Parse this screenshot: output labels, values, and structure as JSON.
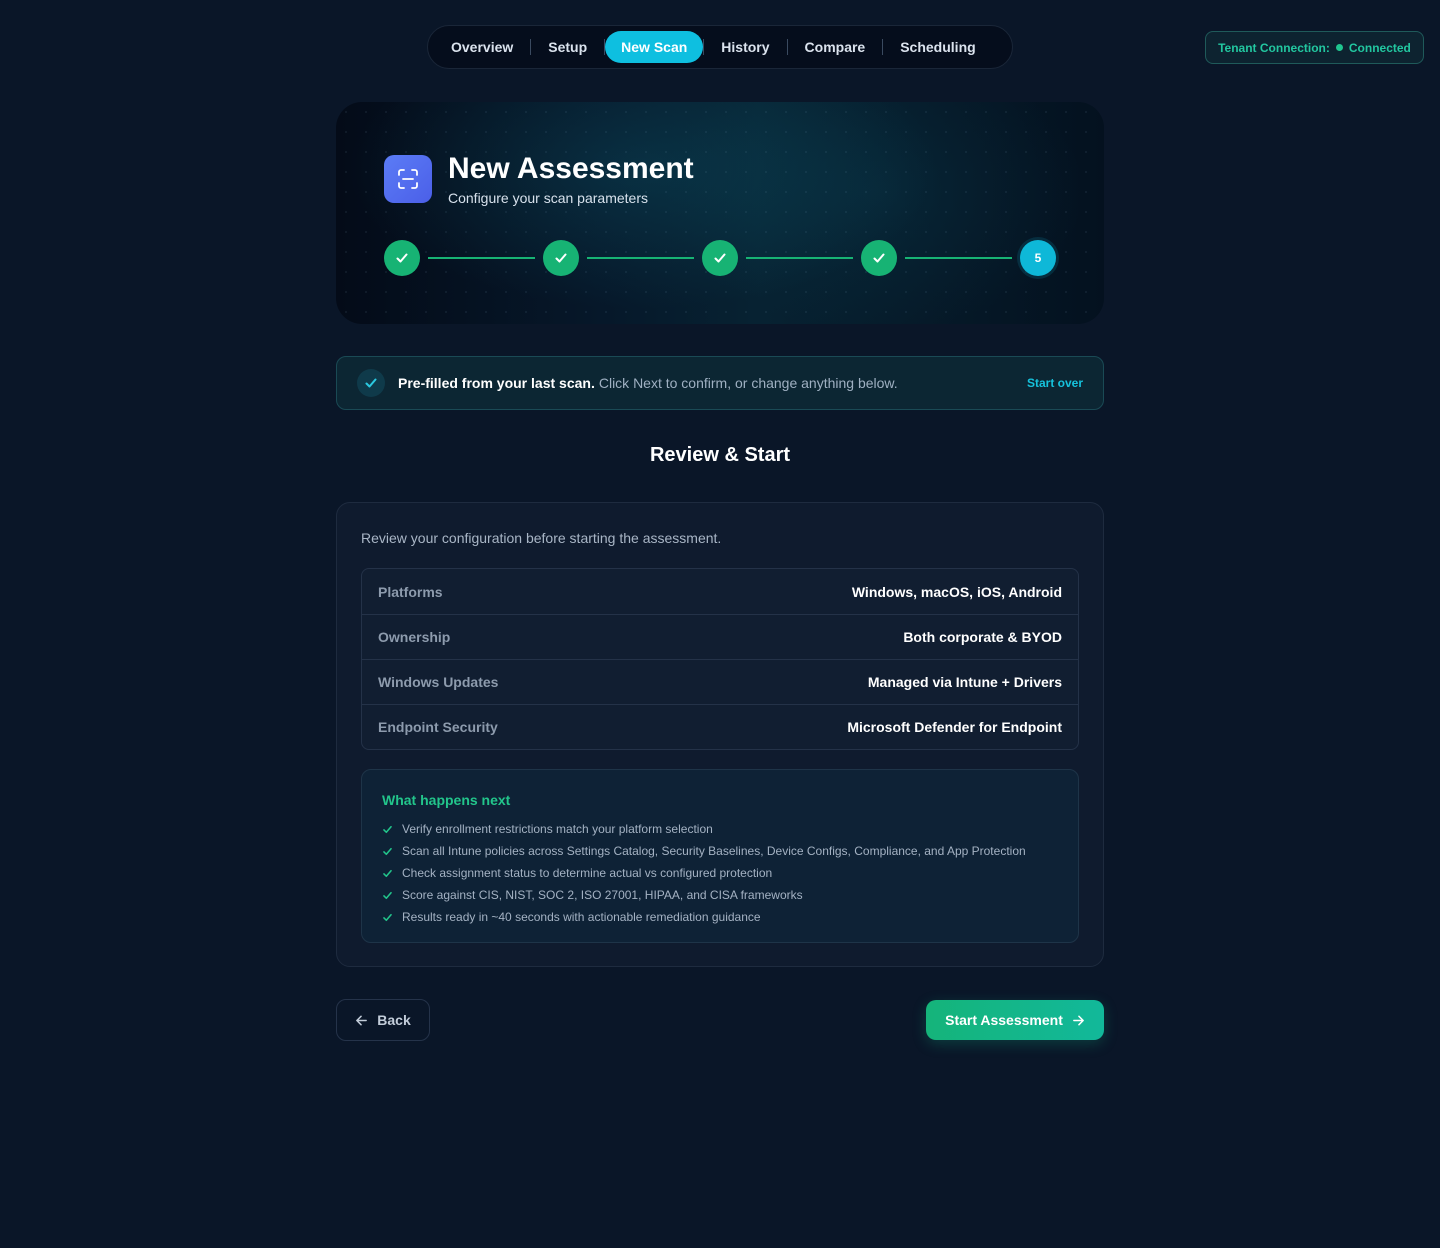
{
  "nav": {
    "items": [
      {
        "label": "Overview",
        "name": "tab-overview"
      },
      {
        "label": "Setup",
        "name": "tab-setup"
      },
      {
        "label": "New Scan",
        "name": "tab-new-scan",
        "active": true
      },
      {
        "label": "History",
        "name": "tab-history"
      },
      {
        "label": "Compare",
        "name": "tab-compare"
      },
      {
        "label": "Scheduling",
        "name": "tab-scheduling"
      }
    ]
  },
  "tenant": {
    "label": "Tenant Connection:",
    "status": "Connected",
    "status_color": "#1fc68f"
  },
  "hero": {
    "icon": "scan-icon",
    "title": "New Assessment",
    "subtitle": "Configure your scan parameters",
    "steps": [
      {
        "state": "done"
      },
      {
        "state": "done"
      },
      {
        "state": "done"
      },
      {
        "state": "done"
      },
      {
        "state": "current",
        "label": "5"
      }
    ]
  },
  "banner": {
    "bold": "Pre-filled from your last scan.",
    "text": "Click Next to confirm, or change anything below.",
    "action": "Start over"
  },
  "section_title": "Review & Start",
  "review": {
    "intro": "Review your configuration before starting the assessment.",
    "rows": [
      {
        "key": "Platforms",
        "value": "Windows, macOS, iOS, Android"
      },
      {
        "key": "Ownership",
        "value": "Both corporate & BYOD"
      },
      {
        "key": "Windows Updates",
        "value": "Managed via Intune + Drivers"
      },
      {
        "key": "Endpoint Security",
        "value": "Microsoft Defender for Endpoint"
      }
    ]
  },
  "next": {
    "title": "What happens next",
    "items": [
      "Verify enrollment restrictions match your platform selection",
      "Scan all Intune policies across Settings Catalog, Security Baselines, Device Configs, Compliance, and App Protection",
      "Check assignment status to determine actual vs configured protection",
      "Score against CIS, NIST, SOC 2, ISO 27001, HIPAA, and CISA frameworks",
      "Results ready in ~40 seconds with actionable remediation guidance"
    ]
  },
  "footer": {
    "back": "Back",
    "start": "Start Assessment"
  },
  "colors": {
    "accent": "#0ebfe0",
    "success": "#17b374",
    "background": "#0a1628"
  }
}
